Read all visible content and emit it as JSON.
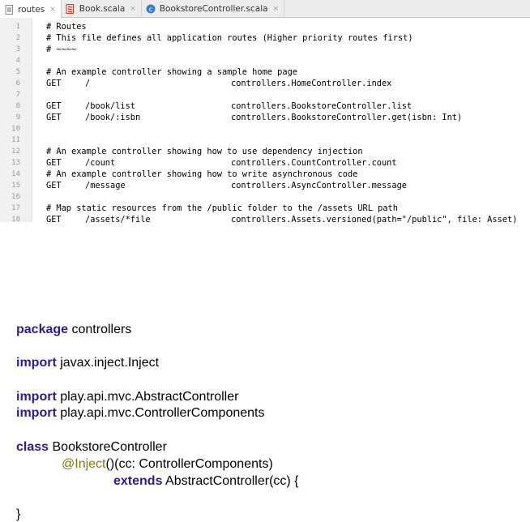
{
  "tabs": [
    {
      "label": "routes",
      "icon": "routes-file-icon",
      "active": true
    },
    {
      "label": "Book.scala",
      "icon": "scala-file-icon",
      "active": false
    },
    {
      "label": "BookstoreController.scala",
      "icon": "scala-class-icon",
      "active": false
    }
  ],
  "tab_close_glyph": "×",
  "routes_lines": [
    {
      "n": "1",
      "comment": "# Routes"
    },
    {
      "n": "2",
      "comment": "# This file defines all application routes (Higher priority routes first)"
    },
    {
      "n": "3",
      "comment": "# ~~~~"
    },
    {
      "n": "4"
    },
    {
      "n": "5",
      "comment": "# An example controller showing a sample home page"
    },
    {
      "n": "6",
      "method": "GET",
      "path": "/",
      "action": "controllers.HomeController.index"
    },
    {
      "n": "7"
    },
    {
      "n": "8",
      "method": "GET",
      "path": "/book/list",
      "action": "controllers.BookstoreController.list"
    },
    {
      "n": "9",
      "method": "GET",
      "path": "/book/:isbn",
      "action": "controllers.BookstoreController.get(isbn: Int)"
    },
    {
      "n": "10"
    },
    {
      "n": "11"
    },
    {
      "n": "12",
      "comment": "# An example controller showing how to use dependency injection"
    },
    {
      "n": "13",
      "method": "GET",
      "path": "/count",
      "action": "controllers.CountController.count"
    },
    {
      "n": "14",
      "comment": "# An example controller showing how to write asynchronous code"
    },
    {
      "n": "15",
      "method": "GET",
      "path": "/message",
      "action": "controllers.AsyncController.message"
    },
    {
      "n": "16"
    },
    {
      "n": "17",
      "comment": "# Map static resources from the /public folder to the /assets URL path"
    },
    {
      "n": "18",
      "method": "GET",
      "path": "/assets/*file",
      "action": "controllers.Assets.versioned(path=\"/public\", file: Asset)"
    }
  ],
  "scala_code": {
    "package_kw": "package",
    "package_name": " controllers",
    "import1_kw": "import",
    "import1_path": " javax.inject.Inject",
    "import2_kw": "import",
    "import2_path": " play.api.mvc.AbstractController",
    "import3_kw": "import",
    "import3_path": " play.api.mvc.ControllerComponents",
    "class_kw": "class",
    "class_name": " BookstoreController",
    "annotation": "@Inject",
    "ctor_params": "()(cc: ControllerComponents)",
    "extends_kw": "extends",
    "extends_target": " AbstractController(cc) {",
    "closing_brace": "}"
  },
  "colors": {
    "keyword": "#2a1f8a",
    "annotation": "#7a7a10",
    "tab_bar": "#ececec",
    "gutter": "#f0f0f0"
  }
}
